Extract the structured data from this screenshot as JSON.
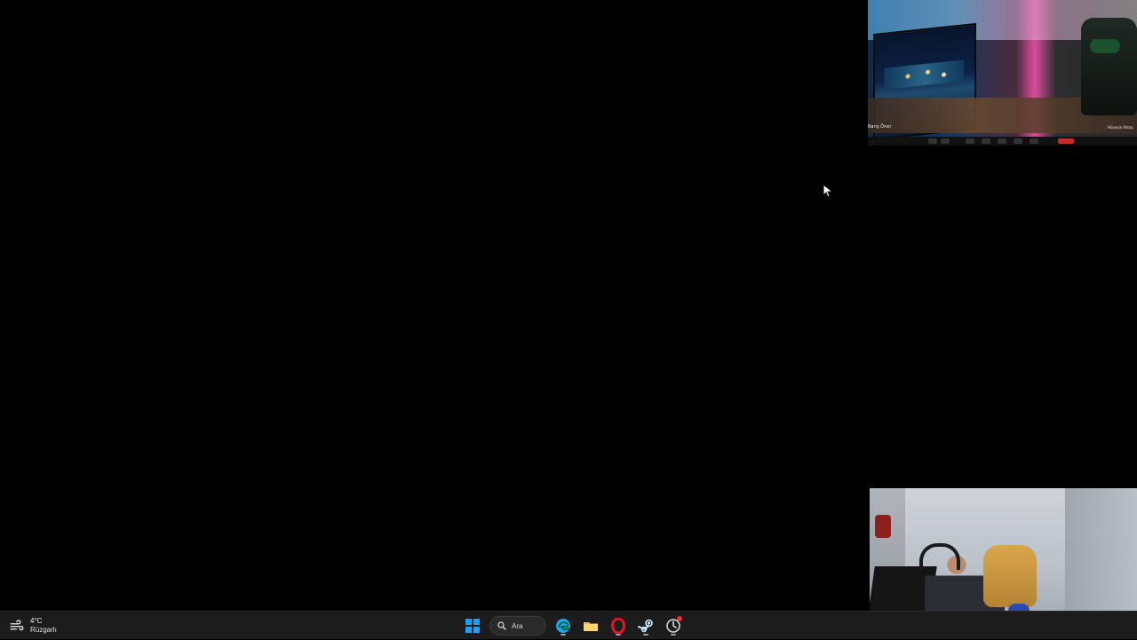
{
  "weather": {
    "temp": "4°C",
    "condition": "Rüzgarlı"
  },
  "taskbar": {
    "search_label": "Ara",
    "apps": [
      {
        "name": "start",
        "icon": "windows-icon"
      },
      {
        "name": "search",
        "icon": "search-icon",
        "label": "Ara"
      },
      {
        "name": "edge",
        "icon": "edge-icon"
      },
      {
        "name": "file-explorer",
        "icon": "folder-icon"
      },
      {
        "name": "opera",
        "icon": "opera-icon"
      },
      {
        "name": "steam",
        "icon": "steam-icon"
      },
      {
        "name": "app-with-notification",
        "icon": "circular-app-icon"
      }
    ]
  },
  "webcam_top": {
    "left_name": "Barış Öner",
    "right_name": "Hüseyin Aktaş"
  },
  "colors": {
    "taskbar_bg": "#1c1c1c",
    "desktop_bg": "#000000",
    "notification_red": "#ff2d2d",
    "windows_blue": "#1aa0ff"
  }
}
